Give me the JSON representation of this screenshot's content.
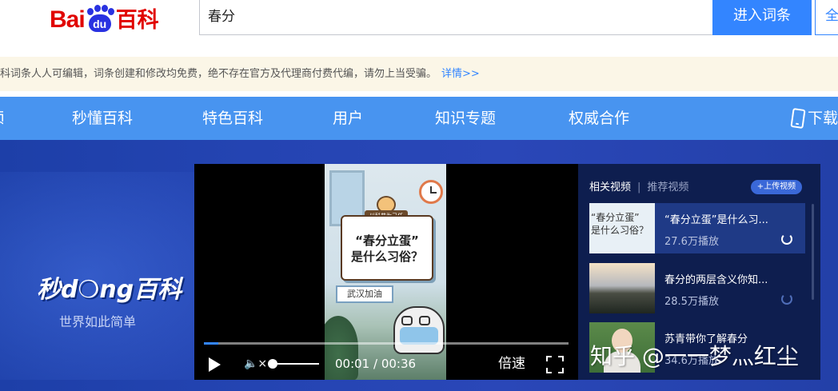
{
  "header": {
    "logo_bai": "Bai",
    "logo_du": "du",
    "logo_baike": "百科",
    "search_value": "春分",
    "enter_button": "进入词条",
    "second_button": "全"
  },
  "notice": {
    "text": "科词条人人可编辑，词条创建和修改均免费，绝不存在官方及代理商付费代编，请勿上当受骗。",
    "link": "详情>>"
  },
  "nav": {
    "cut_label": "页",
    "items": [
      "秒懂百科",
      "特色百科",
      "用户",
      "知识专题",
      "权威合作"
    ],
    "download": "下载"
  },
  "banner": {
    "brand": "秒d❍ng百科",
    "slogan": "世界如此简单"
  },
  "video": {
    "badge_tag": "以科普为己任",
    "card_text": "“春分立蛋”\n是什么习俗？",
    "sign_text": "武汉加油",
    "progress": 0.04,
    "volume": 0.2,
    "time": "00:01 / 00:36",
    "speed": "倍速"
  },
  "side_panel": {
    "tab_active": "相关视频",
    "tab_separator": "|",
    "tab_inactive": "推荐视频",
    "upload": "+上传视频",
    "items": [
      {
        "thumb_text": "“春分立蛋”\n是什么习俗？",
        "title": "“春分立蛋”是什么习...",
        "count": "27.6万播放"
      },
      {
        "thumb_text": "",
        "title": "春分的两层含义你知...",
        "count": "28.5万播放"
      },
      {
        "thumb_text": "",
        "title": "苏青带你了解春分",
        "count": "34.6万播放"
      }
    ]
  },
  "watermark": "知乎 @一一梦灬红尘",
  "colors": {
    "brand_red": "#e10602",
    "brand_blue": "#2932e1",
    "accent": "#3385ff",
    "nav_bg": "#4894f0",
    "banner_bg": "#2444b2"
  }
}
